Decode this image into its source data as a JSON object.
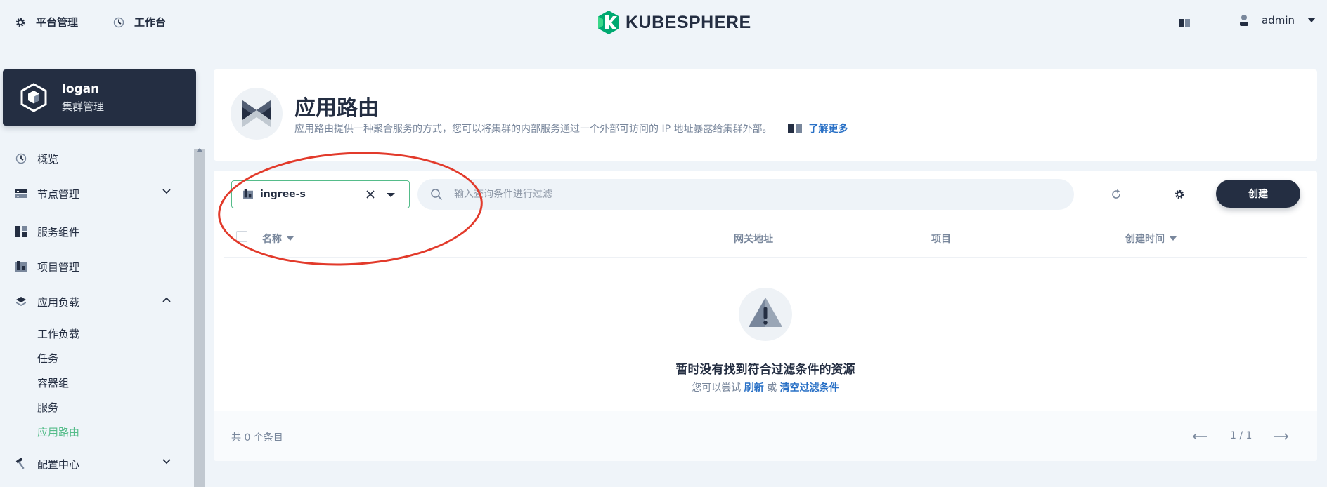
{
  "header": {
    "platform_label": "平台管理",
    "workbench_label": "工作台",
    "logo_text": "KUBESPHERE",
    "username": "admin"
  },
  "cluster": {
    "name": "logan",
    "subtitle": "集群管理"
  },
  "sidebar": {
    "items": [
      {
        "label": "概览"
      },
      {
        "label": "节点管理"
      },
      {
        "label": "服务组件"
      },
      {
        "label": "项目管理"
      },
      {
        "label": "应用负载"
      }
    ],
    "workload_subitems": [
      {
        "label": "工作负载"
      },
      {
        "label": "任务"
      },
      {
        "label": "容器组"
      },
      {
        "label": "服务"
      },
      {
        "label": "应用路由"
      }
    ],
    "config_center": {
      "label": "配置中心"
    }
  },
  "banner": {
    "title": "应用路由",
    "description": "应用路由提供一种聚合服务的方式，您可以将集群的内部服务通过一个外部可访问的 IP 地址暴露给集群外部。",
    "learn_more": "了解更多"
  },
  "toolbar": {
    "project_filter_value": "ingree-s",
    "search_placeholder": "输入查询条件进行过滤",
    "create_label": "创建"
  },
  "table": {
    "columns": [
      {
        "label": "名称"
      },
      {
        "label": "网关地址"
      },
      {
        "label": "项目"
      },
      {
        "label": "创建时间"
      }
    ]
  },
  "empty_state": {
    "title": "暂时没有找到符合过滤条件的资源",
    "prefix": "您可以尝试",
    "refresh_link": "刷新",
    "or_text": "或",
    "clear_link": "清空过滤条件"
  },
  "pagination": {
    "total_text": "共 0 个条目",
    "page_text": "1 / 1"
  },
  "colors": {
    "sidebar_active": "#55bc8a",
    "dark": "#242e42",
    "link": "#2a71c6",
    "annotation": "#e23a2b"
  }
}
